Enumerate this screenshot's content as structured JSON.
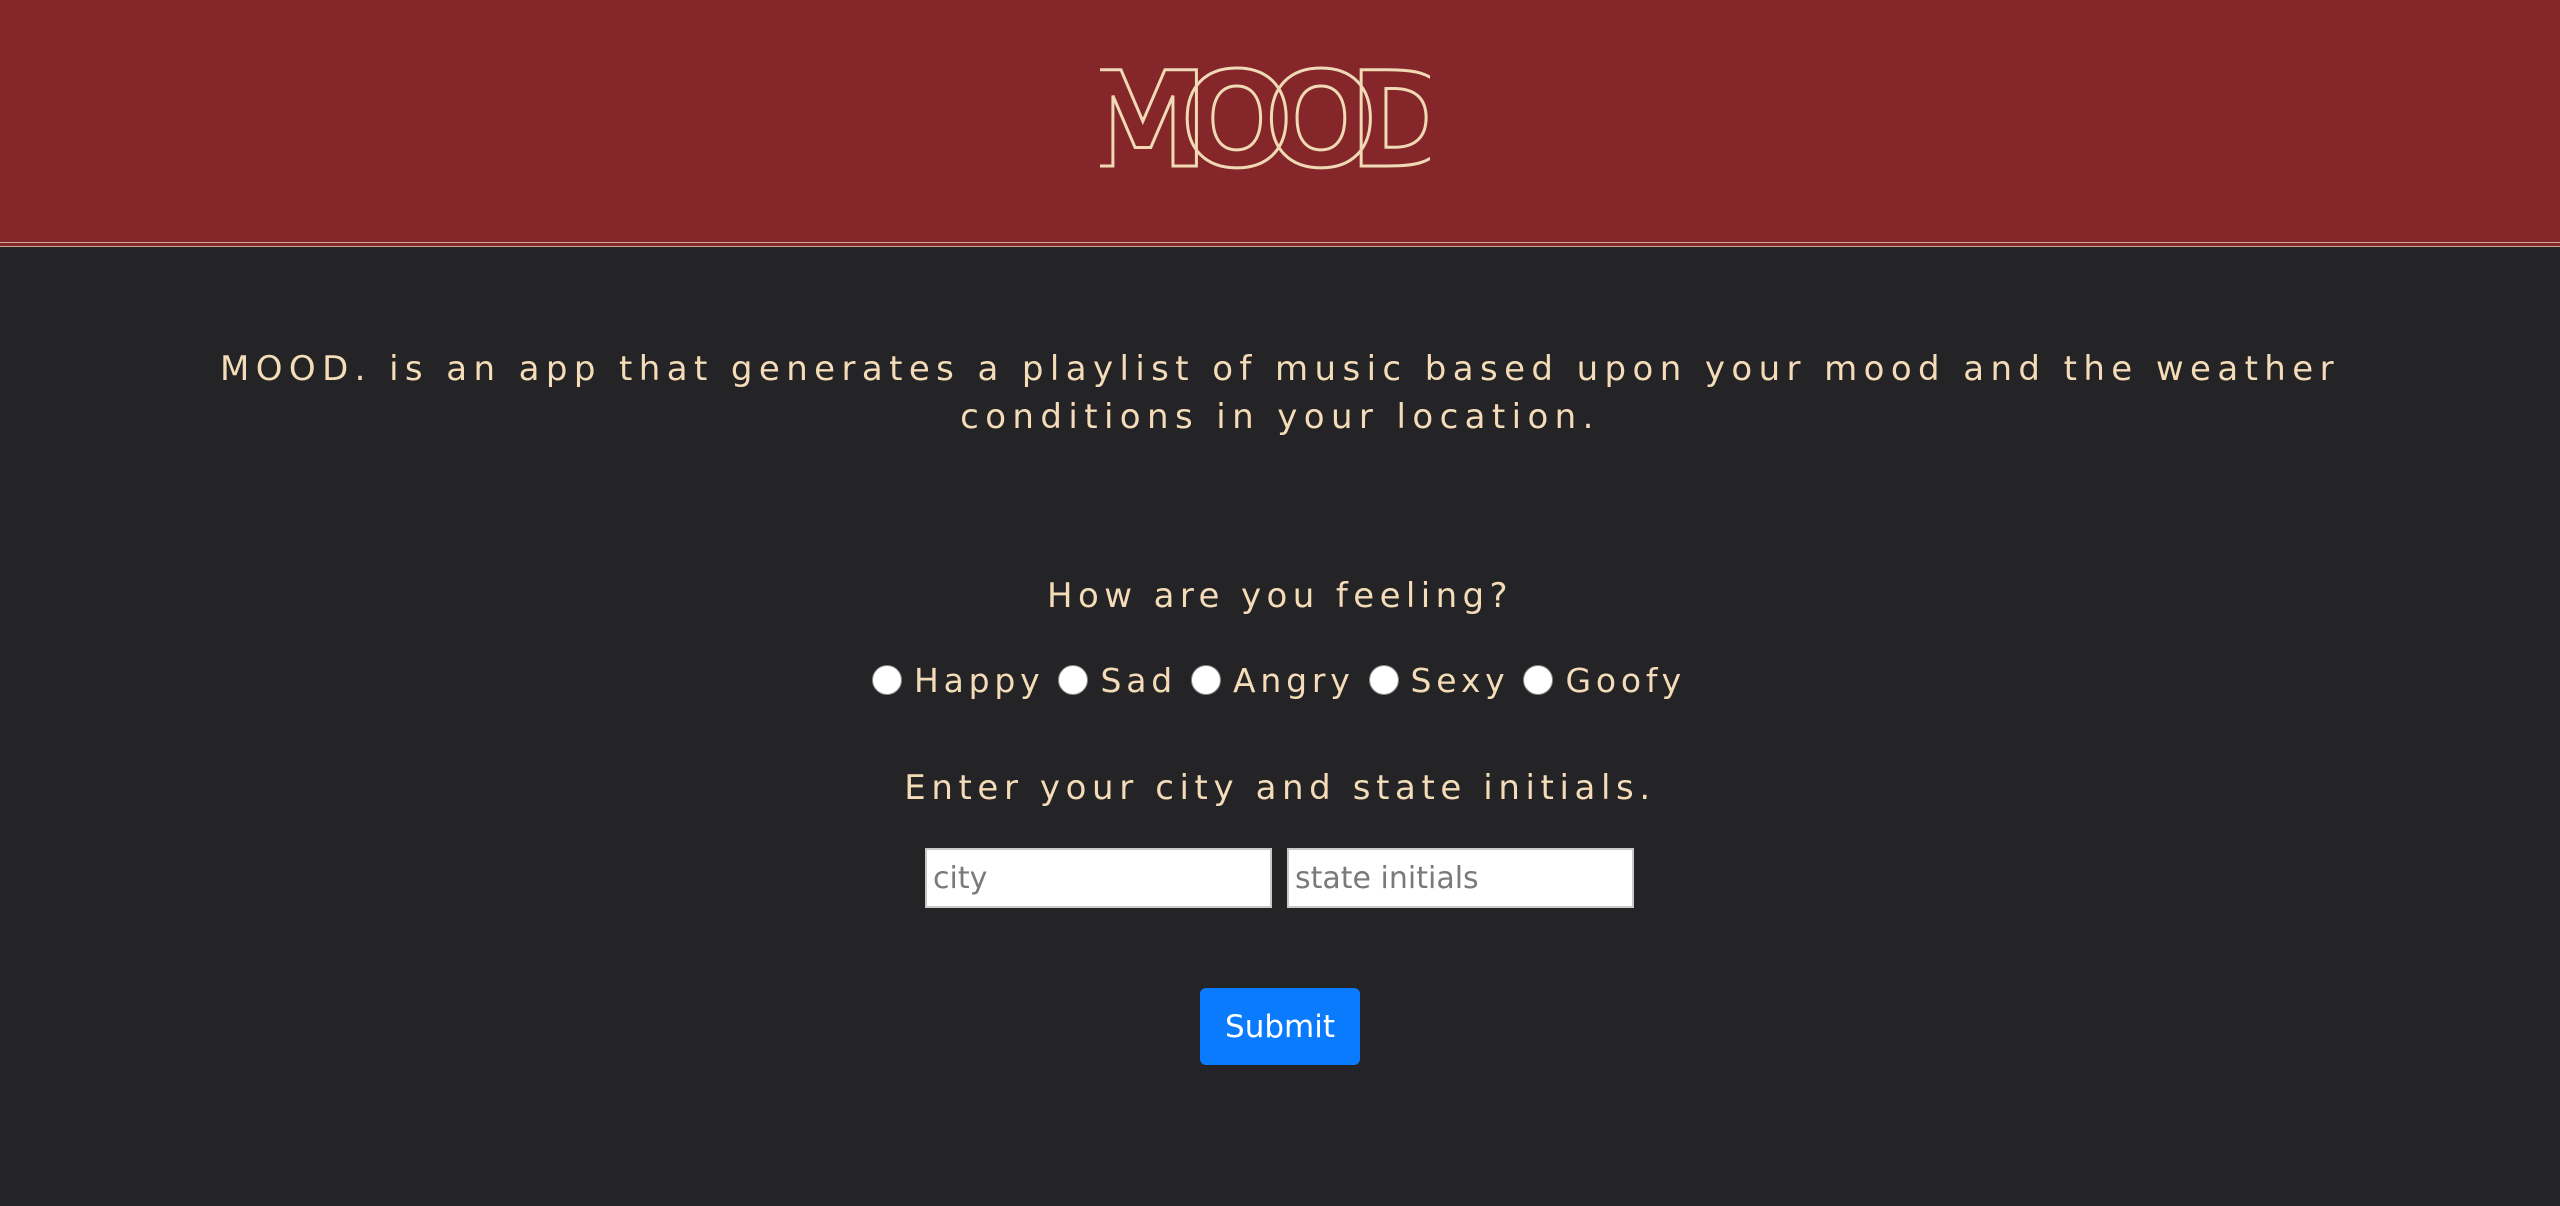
{
  "header": {
    "logo_text": "MOOD.",
    "background_color": "#85272a"
  },
  "intro": {
    "text": "MOOD. is an app that generates a playlist of music based upon your mood and the weather conditions in your location."
  },
  "mood_section": {
    "question": "How are you feeling?",
    "options": [
      {
        "label": "Happy",
        "selected": false
      },
      {
        "label": "Sad",
        "selected": false
      },
      {
        "label": "Angry",
        "selected": false
      },
      {
        "label": "Sexy",
        "selected": false
      },
      {
        "label": "Goofy",
        "selected": false
      }
    ]
  },
  "location_section": {
    "prompt": "Enter your city and state initials.",
    "city": {
      "value": "",
      "placeholder": "city"
    },
    "state": {
      "value": "",
      "placeholder": "state initials"
    }
  },
  "submit": {
    "label": "Submit",
    "color": "#0a7bfd"
  },
  "colors": {
    "page_background": "#242326",
    "text": "#f4dcb8"
  }
}
